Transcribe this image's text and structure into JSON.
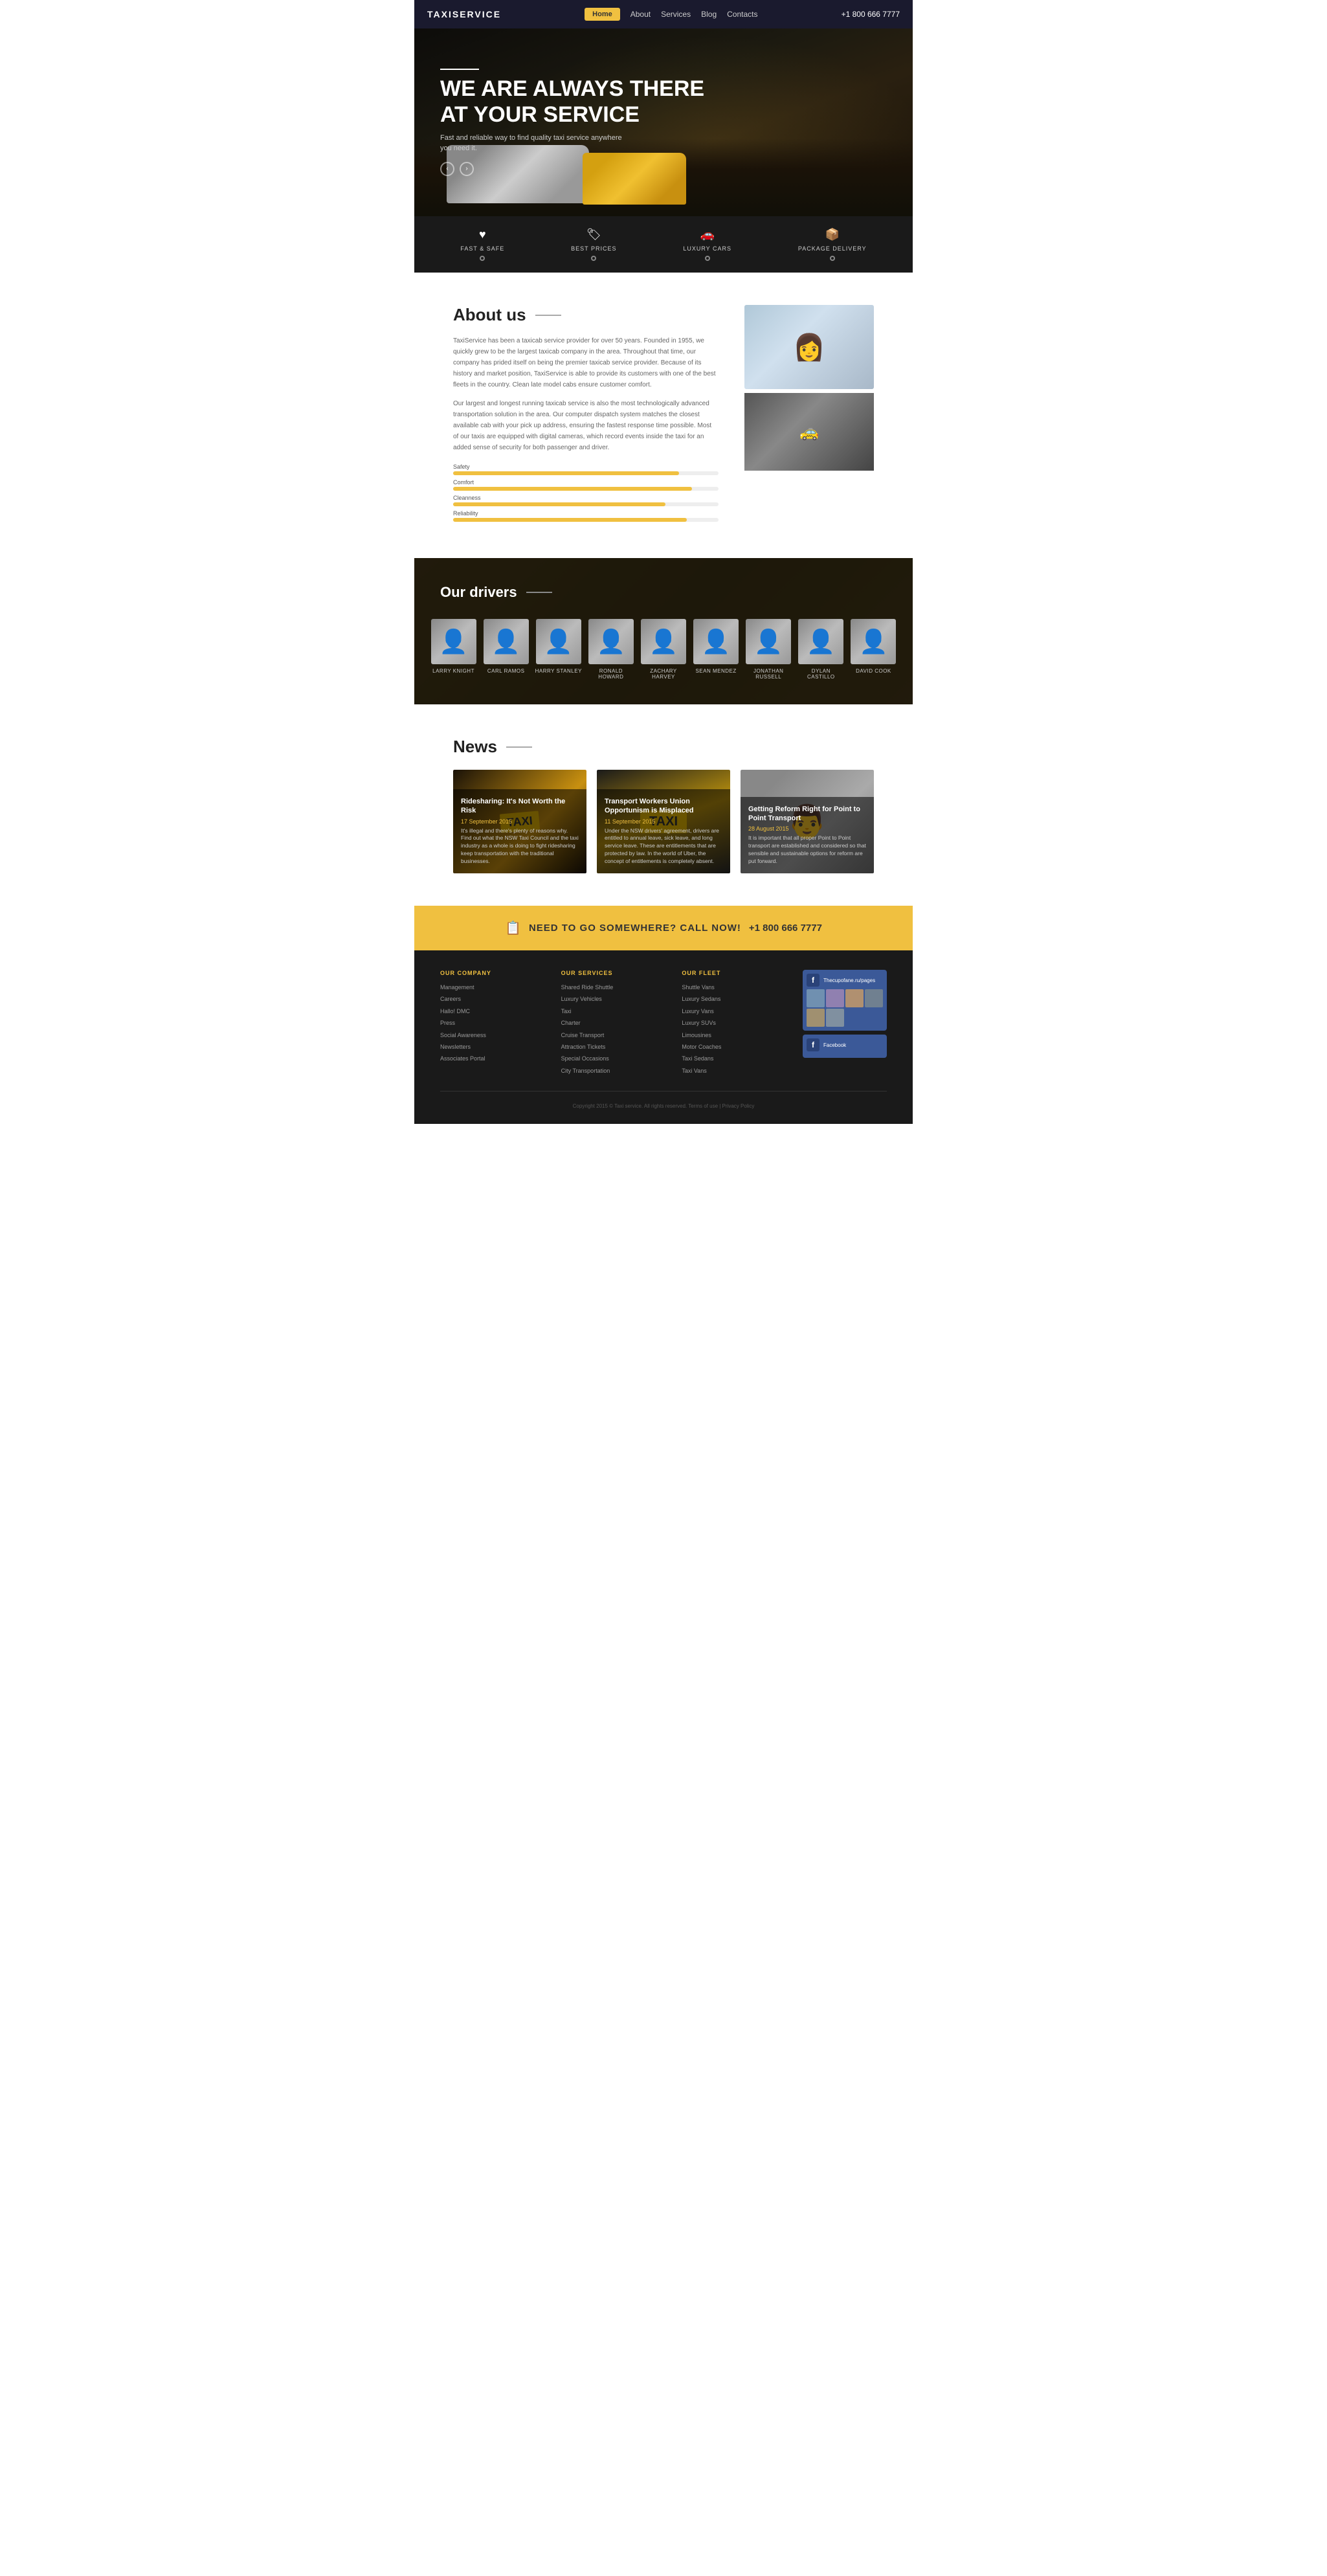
{
  "header": {
    "logo": "TAXISERVICE",
    "nav": [
      "Home",
      "About",
      "Services",
      "Blog",
      "Contacts"
    ],
    "phone": "+1 800 666 7777"
  },
  "hero": {
    "line_text": "——",
    "title_line1": "WE ARE ALWAYS THERE",
    "title_line2": "AT YOUR SERVICE",
    "subtitle": "Fast and reliable way to find quality taxi service anywhere you need it.",
    "arrow_prev": "‹",
    "arrow_next": "›"
  },
  "features": [
    {
      "icon": "♥",
      "label": "FAST & SAFE",
      "active": false
    },
    {
      "icon": "🏷",
      "label": "BEST PRICES",
      "active": false
    },
    {
      "icon": "🚗",
      "label": "LUXURY CARS",
      "active": false
    },
    {
      "icon": "📦",
      "label": "PACKAGE DELIVERY",
      "active": false
    }
  ],
  "about": {
    "title": "About us",
    "text1": "TaxiService has been a taxicab service provider for over 50 years. Founded in 1955, we quickly grew to be the largest taxicab company in the area. Throughout that time, our company has prided itself on being the premier taxicab service provider. Because of its history and market position, TaxiService is able to provide its customers with one of the best fleets in the country. Clean late model cabs ensure customer comfort.",
    "text2": "Our largest and longest running taxicab service is also the most technologically advanced transportation solution in the area. Our computer dispatch system matches the closest available cab with your pick up address, ensuring the fastest response time possible. Most of our taxis are equipped with digital cameras, which record events inside the taxi for an added sense of security for both passenger and driver.",
    "progress": [
      {
        "label": "Safety",
        "value": 85
      },
      {
        "label": "Comfort",
        "value": 90
      },
      {
        "label": "Cleanness",
        "value": 80
      },
      {
        "label": "Reliability",
        "value": 88
      }
    ]
  },
  "drivers": {
    "title": "Our drivers",
    "list": [
      {
        "name": "LARRY KNIGHT"
      },
      {
        "name": "CARL RAMOS"
      },
      {
        "name": "HARRY STANLEY"
      },
      {
        "name": "RONALD HOWARD"
      },
      {
        "name": "ZACHARY HARVEY"
      },
      {
        "name": "SEAN MENDEZ"
      },
      {
        "name": "JONATHAN RUSSELL"
      },
      {
        "name": "DYLAN CASTILLO"
      },
      {
        "name": "DAVID COOK"
      }
    ]
  },
  "news": {
    "title": "News",
    "items": [
      {
        "title": "Ridesharing: It's Not Worth the Risk",
        "date": "17 September 2015",
        "desc": "It's illegal and there's plenty of reasons why. Find out what the NSW Taxi Council and the taxi industry as a whole is doing to fight ridesharing keep transportation with the traditional businesses.",
        "img_type": "taxi"
      },
      {
        "title": "Transport Workers Union Opportunism is Misplaced",
        "date": "11 September 2015",
        "desc": "Under the NSW drivers' agreement, drivers are entitled to annual leave, sick leave, and long service leave. These are entitlements that are protected by law. In the world of Uber, the concept of entitlements is completely absent.",
        "img_type": "taxi2"
      },
      {
        "title": "Getting Reform Right for Point to Point Transport",
        "date": "28 August 2015",
        "desc": "It is important that all proper Point to Point transport are established and considered so that sensible and sustainable options for reform are put forward.",
        "img_type": "person"
      }
    ]
  },
  "cta": {
    "icon": "📋",
    "text": "NEED TO GO SOMEWHERE? CALL NOW!",
    "phone": "+1 800 666 7777"
  },
  "footer": {
    "our_company_title": "OUR COMPANY",
    "our_company_links": [
      "Management",
      "Careers",
      "Hallo! DMC",
      "Press",
      "Social Awareness",
      "Newsletters",
      "Associates Portal"
    ],
    "our_services_title": "OUR SERVICES",
    "our_services_links": [
      "Shared Ride Shuttle",
      "Luxury Vehicles",
      "Taxi",
      "Charter",
      "Cruise Transport",
      "Attraction Tickets",
      "Special Occasions",
      "City Transportation"
    ],
    "our_fleet_title": "OUR FLEET",
    "our_fleet_links": [
      "Shuttle Vans",
      "Luxury Sedans",
      "Luxury Vans",
      "Luxury SUVs",
      "Limousines",
      "Motor Coaches",
      "Taxi Sedans",
      "Taxi Vans"
    ],
    "facebook_name": "Thecupofane.ru/pages",
    "copyright": "Copyright 2015 © Taxi service. All rights reserved. Terms of use  |  Privacy Policy"
  }
}
